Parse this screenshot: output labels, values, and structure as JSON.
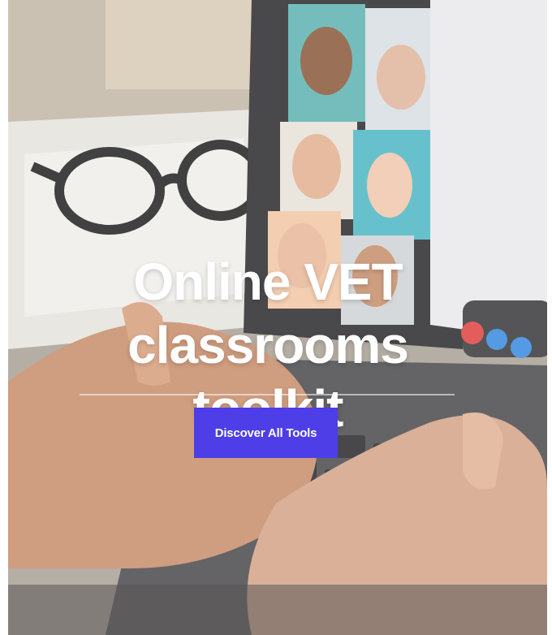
{
  "hero": {
    "title_line1": "Online VET",
    "title_line2": "classrooms toolkit",
    "cta_label": "Discover All Tools",
    "colors": {
      "cta_background": "#4d3ee7",
      "title_text": "#ffffff"
    }
  }
}
